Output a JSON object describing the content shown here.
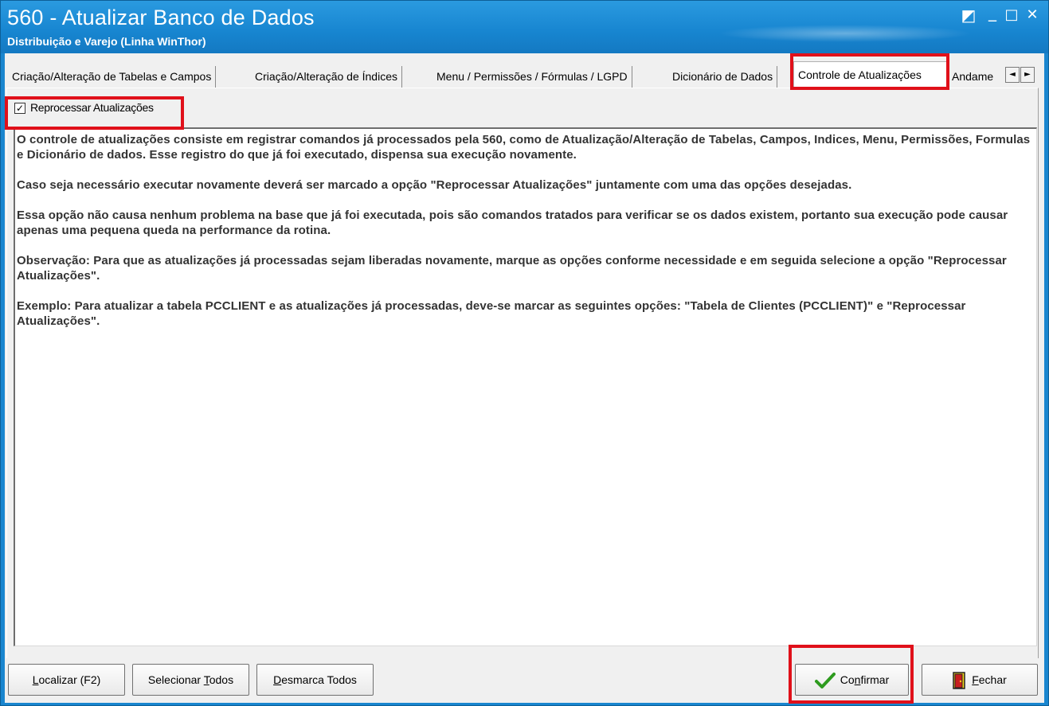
{
  "window": {
    "title": "560 - Atualizar Banco de Dados",
    "subtitle": "Distribuição e Varejo (Linha WinThor)",
    "controls": {
      "restore": "◩",
      "minimize": "_",
      "maximize": "□",
      "close": "✕"
    }
  },
  "tabs": [
    {
      "label": "Criação/Alteração de Tabelas e Campos",
      "active": false
    },
    {
      "label": "Criação/Alteração de Índices",
      "active": false
    },
    {
      "label": "Menu / Permissões / Fórmulas / LGPD",
      "active": false
    },
    {
      "label": "Dicionário de Dados",
      "active": false
    },
    {
      "label": "Controle de Atualizações",
      "active": true
    },
    {
      "label": "Andame",
      "active": false
    }
  ],
  "tab_scroll": {
    "left": "◄",
    "right": "►"
  },
  "reprocess": {
    "label": "Reprocessar Atualizações",
    "checked": true,
    "mark": "✓"
  },
  "description": [
    "O controle de atualizações consiste em registrar comandos já processados pela 560, como de Atualização/Alteração de Tabelas, Campos, Indices, Menu, Permissões, Formulas e Dicionário de dados. Esse registro do que já foi executado, dispensa sua execução novamente.",
    "Caso seja necessário executar novamente deverá ser marcado a opção \"Reprocessar Atualizações\" juntamente com uma das opções desejadas.",
    "Essa opção não causa nenhum problema na base que já foi executada, pois são comandos tratados para verificar se os dados existem, portanto sua execução pode causar apenas uma pequena queda na performance da rotina.",
    "Observação: Para que as atualizações já processadas sejam liberadas novamente, marque as opções conforme necessidade e em seguida selecione a opção \"Reprocessar Atualizações\".",
    "Exemplo: Para atualizar a tabela PCCLIENT e as atualizações já processadas, deve-se marcar as seguintes opções: \"Tabela de Clientes (PCCLIENT)\" e \"Reprocessar Atualizações\"."
  ],
  "buttons": {
    "find": {
      "hotkey": "L",
      "rest": "ocalizar (F2)"
    },
    "select_all": {
      "before": "Selecionar ",
      "hotkey": "T",
      "after": "odos"
    },
    "unselect_all": {
      "hotkey": "D",
      "rest": "esmarca Todos"
    },
    "confirm": {
      "before": "Co",
      "hotkey": "n",
      "after": "firmar"
    },
    "close": {
      "hotkey": "F",
      "rest": "echar"
    }
  },
  "colors": {
    "title_bar": "#1a86cf",
    "highlight": "#e0101a",
    "check_green": "#2e9b1f"
  }
}
